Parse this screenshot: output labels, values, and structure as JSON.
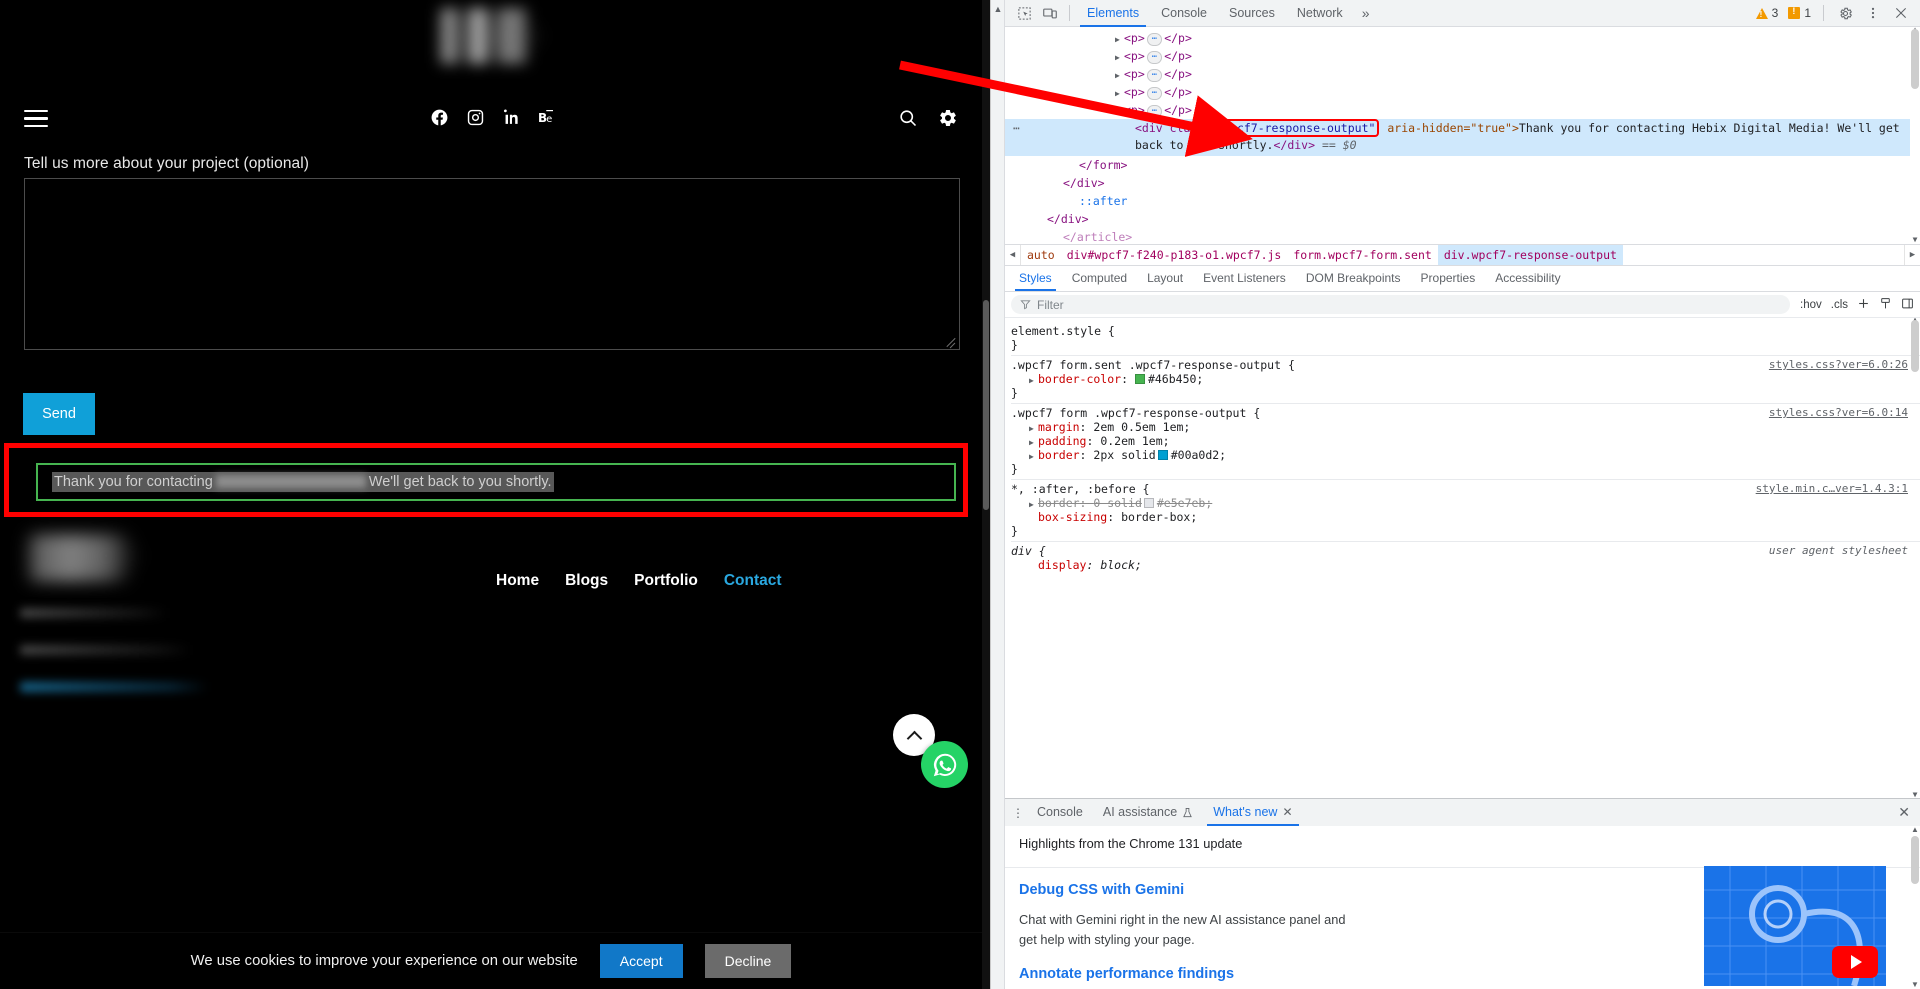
{
  "site": {
    "logo_alt": "blurred-logo",
    "nav": {
      "menu_icon": "hamburger-menu-icon",
      "socials": [
        {
          "name": "facebook-icon",
          "label": "Facebook"
        },
        {
          "name": "instagram-icon",
          "label": "Instagram"
        },
        {
          "name": "linkedin-icon",
          "label": "LinkedIn"
        },
        {
          "name": "behance-icon",
          "label": "Behance"
        }
      ],
      "search_icon": "search-icon",
      "settings_icon": "gear-icon"
    },
    "form": {
      "textarea_label": "Tell us more about your project (optional)",
      "textarea_value": "",
      "send_label": "Send"
    },
    "response": {
      "text_before": "Thank you for contacting",
      "redacted": "",
      "text_after": "We'll get back to you shortly.",
      "border_color": "#46b450"
    },
    "footer": {
      "nav": [
        {
          "label": "Home",
          "active": false
        },
        {
          "label": "Blogs",
          "active": false
        },
        {
          "label": "Portfolio",
          "active": false
        },
        {
          "label": "Contact",
          "active": true
        }
      ]
    },
    "cookie": {
      "message": "We use cookies to improve your experience on our website",
      "accept_label": "Accept",
      "decline_label": "Decline",
      "accept_color": "#1178c8",
      "decline_color": "#6b6b6b"
    },
    "fab": {
      "scroll_top": "chevron-up-icon",
      "whatsapp": "whatsapp-icon"
    }
  },
  "devtools": {
    "toolbar": {
      "inspect_icon": "inspect-element-icon",
      "device_icon": "device-toolbar-icon",
      "tabs": [
        {
          "label": "Elements",
          "active": true
        },
        {
          "label": "Console",
          "active": false
        },
        {
          "label": "Sources",
          "active": false
        },
        {
          "label": "Network",
          "active": false
        }
      ],
      "overflow": "»",
      "warning_count": "3",
      "issue_count": "1",
      "settings_icon": "gear-icon",
      "kebab_icon": "more-options-icon",
      "close_icon": "close-icon"
    },
    "dom": {
      "collapsed_rows": [
        {
          "tag_open": "<p>",
          "tag_close": "</p>"
        },
        {
          "tag_open": "<p>",
          "tag_close": "</p>"
        },
        {
          "tag_open": "<p>",
          "tag_close": "</p>"
        },
        {
          "tag_open": "<p>",
          "tag_close": "</p>"
        },
        {
          "tag_open": "<p>",
          "tag_close": "</p>"
        }
      ],
      "selected": {
        "prefix": "<div class=",
        "class_value": "\"wpcf7-response-output\"",
        "attr": " aria-hidden=\"true\">",
        "text": "Thank you for contacting Hebix Digital Media! We'll get back to you shortly.",
        "close_tag": "</div>",
        "eq": "== $0"
      },
      "trailing": [
        {
          "text": "</form>",
          "indent": 74
        },
        {
          "text": "</div>",
          "indent": 58
        },
        {
          "text": "::after",
          "indent": 74,
          "pseudo": true
        },
        {
          "text": "</div>",
          "indent": 42
        },
        {
          "text": "</article>",
          "indent": 58
        }
      ]
    },
    "breadcrumb": {
      "left_arrow": "◀",
      "right_arrow": "▶",
      "items": [
        {
          "label": "auto",
          "selected": false,
          "auto": true
        },
        {
          "label": "div#wpcf7-f240-p183-o1.wpcf7.js",
          "selected": false
        },
        {
          "label": "form.wpcf7-form.sent",
          "selected": false
        },
        {
          "label": "div.wpcf7-response-output",
          "selected": true
        }
      ]
    },
    "subtabs": [
      {
        "label": "Styles",
        "active": true
      },
      {
        "label": "Computed",
        "active": false
      },
      {
        "label": "Layout",
        "active": false
      },
      {
        "label": "Event Listeners",
        "active": false
      },
      {
        "label": "DOM Breakpoints",
        "active": false
      },
      {
        "label": "Properties",
        "active": false
      },
      {
        "label": "Accessibility",
        "active": false
      }
    ],
    "filter": {
      "placeholder": "Filter",
      "icon": "filter-icon",
      "hov": ":hov",
      "cls": ".cls",
      "new_rule_icon": "plus-icon",
      "class_icon": "element-classes-icon",
      "sidebar_icon": "toggle-sidebar-icon"
    },
    "styles": [
      {
        "selector": "element.style {",
        "source": "",
        "props": [],
        "close": "}"
      },
      {
        "selector": ".wpcf7 form.sent .wpcf7-response-output {",
        "source": "styles.css?ver=6.0:26",
        "props": [
          {
            "name": "border-color",
            "value": "#46b450",
            "swatch": "#46b450",
            "expand": true,
            "disabled": false
          }
        ],
        "close": "}"
      },
      {
        "selector": ".wpcf7 form .wpcf7-response-output {",
        "source": "styles.css?ver=6.0:14",
        "props": [
          {
            "name": "margin",
            "value": "2em 0.5em 1em",
            "expand": true,
            "disabled": false
          },
          {
            "name": "padding",
            "value": "0.2em 1em",
            "expand": true,
            "disabled": false
          },
          {
            "name": "border",
            "value": "2px solid #00a0d2",
            "swatch": "#00a0d2",
            "expand": true,
            "disabled": false
          }
        ],
        "close": "}"
      },
      {
        "selector": "*, :after, :before {",
        "source": "style.min.c…ver=1.4.3:1",
        "props": [
          {
            "name": "border",
            "value": "0 solid #e5e7eb",
            "swatch": "#e5e7eb",
            "expand": true,
            "disabled": true
          },
          {
            "name": "box-sizing",
            "value": "border-box",
            "disabled": false
          }
        ],
        "close": "}"
      },
      {
        "selector": "div {",
        "source": "user agent stylesheet",
        "ua": true,
        "props": [
          {
            "name": "display",
            "value": "block",
            "disabled": false
          }
        ],
        "close": "}"
      }
    ],
    "drawer": {
      "kebab": "more-tools-icon",
      "tabs": [
        {
          "label": "Console",
          "active": false,
          "closable": false
        },
        {
          "label": "AI assistance",
          "active": false,
          "closable": false,
          "icon": "flask-icon"
        },
        {
          "label": "What's new",
          "active": true,
          "closable": true
        }
      ],
      "close_icon": "close-drawer-icon",
      "whats_new": {
        "subtitle": "Highlights from the Chrome 131 update",
        "items": [
          {
            "heading": "Debug CSS with Gemini",
            "body": "Chat with Gemini right in the new AI assistance panel and get help with styling your page."
          },
          {
            "heading": "Annotate performance findings",
            "body": ""
          }
        ],
        "thumbnail": "chrome-devtools-video-thumbnail",
        "play_badge": "youtube-play-icon"
      }
    }
  },
  "annotations": {
    "arrow_color": "#ff0000",
    "highlight_color": "#ff0000"
  }
}
